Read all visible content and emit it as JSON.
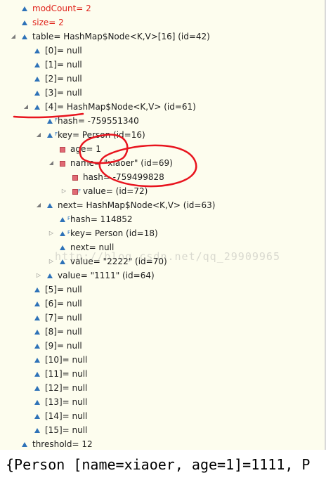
{
  "tree": {
    "rows": [
      {
        "label": "modCount= 2",
        "indent": 0,
        "toggle": "",
        "icon": "field-icon",
        "color": "red"
      },
      {
        "label": "size= 2",
        "indent": 0,
        "toggle": "",
        "icon": "field-icon",
        "color": "red"
      },
      {
        "label": "table= HashMap$Node<K,V>[16]  (id=42)",
        "indent": 0,
        "toggle": "expanded",
        "icon": "field-icon",
        "color": ""
      },
      {
        "label": "[0]= null",
        "indent": 1,
        "toggle": "",
        "icon": "field-icon",
        "color": ""
      },
      {
        "label": "[1]= null",
        "indent": 1,
        "toggle": "",
        "icon": "field-icon",
        "color": ""
      },
      {
        "label": "[2]= null",
        "indent": 1,
        "toggle": "",
        "icon": "field-icon",
        "color": ""
      },
      {
        "label": "[3]= null",
        "indent": 1,
        "toggle": "",
        "icon": "field-icon",
        "color": ""
      },
      {
        "label": "[4]= HashMap$Node<K,V>  (id=61)",
        "indent": 1,
        "toggle": "expanded",
        "icon": "field-icon",
        "color": ""
      },
      {
        "label": "hash= -759551340",
        "indent": 2,
        "toggle": "",
        "icon": "final-field-icon",
        "color": ""
      },
      {
        "label": "key= Person  (id=16)",
        "indent": 2,
        "toggle": "expanded",
        "icon": "final-field-icon",
        "color": ""
      },
      {
        "label": "age= 1",
        "indent": 3,
        "toggle": "",
        "icon": "private-field-icon",
        "color": ""
      },
      {
        "label": "name= \"xiaoer\" (id=69)",
        "indent": 3,
        "toggle": "expanded",
        "icon": "private-field-icon",
        "color": ""
      },
      {
        "label": "hash= -759499828",
        "indent": 4,
        "toggle": "",
        "icon": "private-field-icon",
        "color": ""
      },
      {
        "label": "value= (id=72)",
        "indent": 4,
        "toggle": "collapsed",
        "icon": "private-final-field-icon",
        "color": ""
      },
      {
        "label": "next= HashMap$Node<K,V>  (id=63)",
        "indent": 2,
        "toggle": "expanded",
        "icon": "field-icon",
        "color": ""
      },
      {
        "label": "hash= 114852",
        "indent": 3,
        "toggle": "",
        "icon": "final-field-icon",
        "color": ""
      },
      {
        "label": "key= Person  (id=18)",
        "indent": 3,
        "toggle": "collapsed",
        "icon": "final-field-icon",
        "color": ""
      },
      {
        "label": "next= null",
        "indent": 3,
        "toggle": "",
        "icon": "field-icon",
        "color": ""
      },
      {
        "label": "value= \"2222\" (id=70)",
        "indent": 3,
        "toggle": "collapsed",
        "icon": "field-icon",
        "color": ""
      },
      {
        "label": "value= \"1111\" (id=64)",
        "indent": 2,
        "toggle": "collapsed",
        "icon": "field-icon",
        "color": ""
      },
      {
        "label": "[5]= null",
        "indent": 1,
        "toggle": "",
        "icon": "field-icon",
        "color": ""
      },
      {
        "label": "[6]= null",
        "indent": 1,
        "toggle": "",
        "icon": "field-icon",
        "color": ""
      },
      {
        "label": "[7]= null",
        "indent": 1,
        "toggle": "",
        "icon": "field-icon",
        "color": ""
      },
      {
        "label": "[8]= null",
        "indent": 1,
        "toggle": "",
        "icon": "field-icon",
        "color": ""
      },
      {
        "label": "[9]= null",
        "indent": 1,
        "toggle": "",
        "icon": "field-icon",
        "color": ""
      },
      {
        "label": "[10]= null",
        "indent": 1,
        "toggle": "",
        "icon": "field-icon",
        "color": ""
      },
      {
        "label": "[11]= null",
        "indent": 1,
        "toggle": "",
        "icon": "field-icon",
        "color": ""
      },
      {
        "label": "[12]= null",
        "indent": 1,
        "toggle": "",
        "icon": "field-icon",
        "color": ""
      },
      {
        "label": "[13]= null",
        "indent": 1,
        "toggle": "",
        "icon": "field-icon",
        "color": ""
      },
      {
        "label": "[14]= null",
        "indent": 1,
        "toggle": "",
        "icon": "field-icon",
        "color": ""
      },
      {
        "label": "[15]= null",
        "indent": 1,
        "toggle": "",
        "icon": "field-icon",
        "color": ""
      },
      {
        "label": "threshold= 12",
        "indent": 0,
        "toggle": "",
        "icon": "field-icon",
        "color": ""
      }
    ]
  },
  "watermark": "http://blog.csdn.net/qq_29909965",
  "console": {
    "output": "{Person [name=xiaoer, age=1]=1111, P"
  },
  "colors": {
    "tree_background": "#fdfdee",
    "changed_value": "#e0221a",
    "icon_blue": "#2e72b8",
    "private_icon": "#e06a74",
    "annotation_ink": "#e8141e"
  }
}
